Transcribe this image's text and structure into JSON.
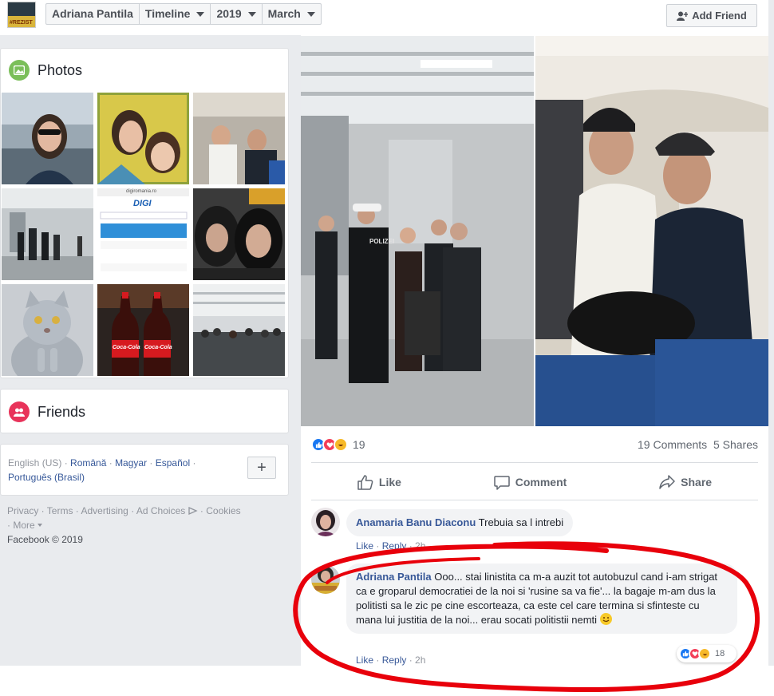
{
  "header": {
    "avatar_caption": "#REZIST",
    "breadcrumbs": [
      {
        "label": "Adriana Pantila"
      },
      {
        "label": "Timeline"
      },
      {
        "label": "2019"
      },
      {
        "label": "March"
      }
    ],
    "add_friend_label": "Add Friend"
  },
  "sidebar": {
    "photos_title": "Photos",
    "friends_title": "Friends",
    "languages": {
      "current": "English (US)",
      "options": [
        "Română",
        "Magyar",
        "Español",
        "Português (Brasil)"
      ],
      "more_button": "+"
    },
    "footer": {
      "links": [
        "Privacy",
        "Terms",
        "Advertising",
        "Ad Choices",
        "Cookies",
        "More"
      ],
      "copyright": "Facebook © 2019"
    },
    "thumb_texts": {
      "digi_url": "digiromania.ro",
      "digi_logo": "DIGI",
      "coke_label": "Coca-Cola"
    }
  },
  "post": {
    "photo_sign": "POLIZEI",
    "reaction_count": "19",
    "comments_count": "19 Comments",
    "shares_count": "5 Shares",
    "actions": {
      "like": "Like",
      "comment": "Comment",
      "share": "Share"
    }
  },
  "comments": [
    {
      "author": "Anamaria Banu Diaconu",
      "text": "Trebuia sa l intrebi",
      "like": "Like",
      "reply": "Reply",
      "time": "2h"
    },
    {
      "author": "Adriana Pantila",
      "text": "Ooo... stai linistita ca m-a auzit tot autobuzul cand i-am strigat ca e groparul democratiei de la noi si 'rusine sa va fie'... la bagaje m-am dus la politisti sa le zic pe cine escorteaza, ca este cel care termina si sfinteste cu mana lui justitia de la noi... erau socati politistii nemti",
      "like": "Like",
      "reply": "Reply",
      "time": "2h",
      "reaction_count": "18"
    }
  ],
  "colors": {
    "link_blue": "#385898",
    "like_blue": "#1877f2",
    "love_red": "#f33e58",
    "haha_yellow": "#f7b928",
    "annotation_red": "#e8000b",
    "page_bg": "#e9ebee"
  },
  "icons": {
    "photos": "image-icon",
    "friends": "friends-icon",
    "add_friend": "person-plus-icon",
    "like": "thumbs-up-icon",
    "comment": "speech-bubble-icon",
    "share": "share-arrow-icon"
  }
}
